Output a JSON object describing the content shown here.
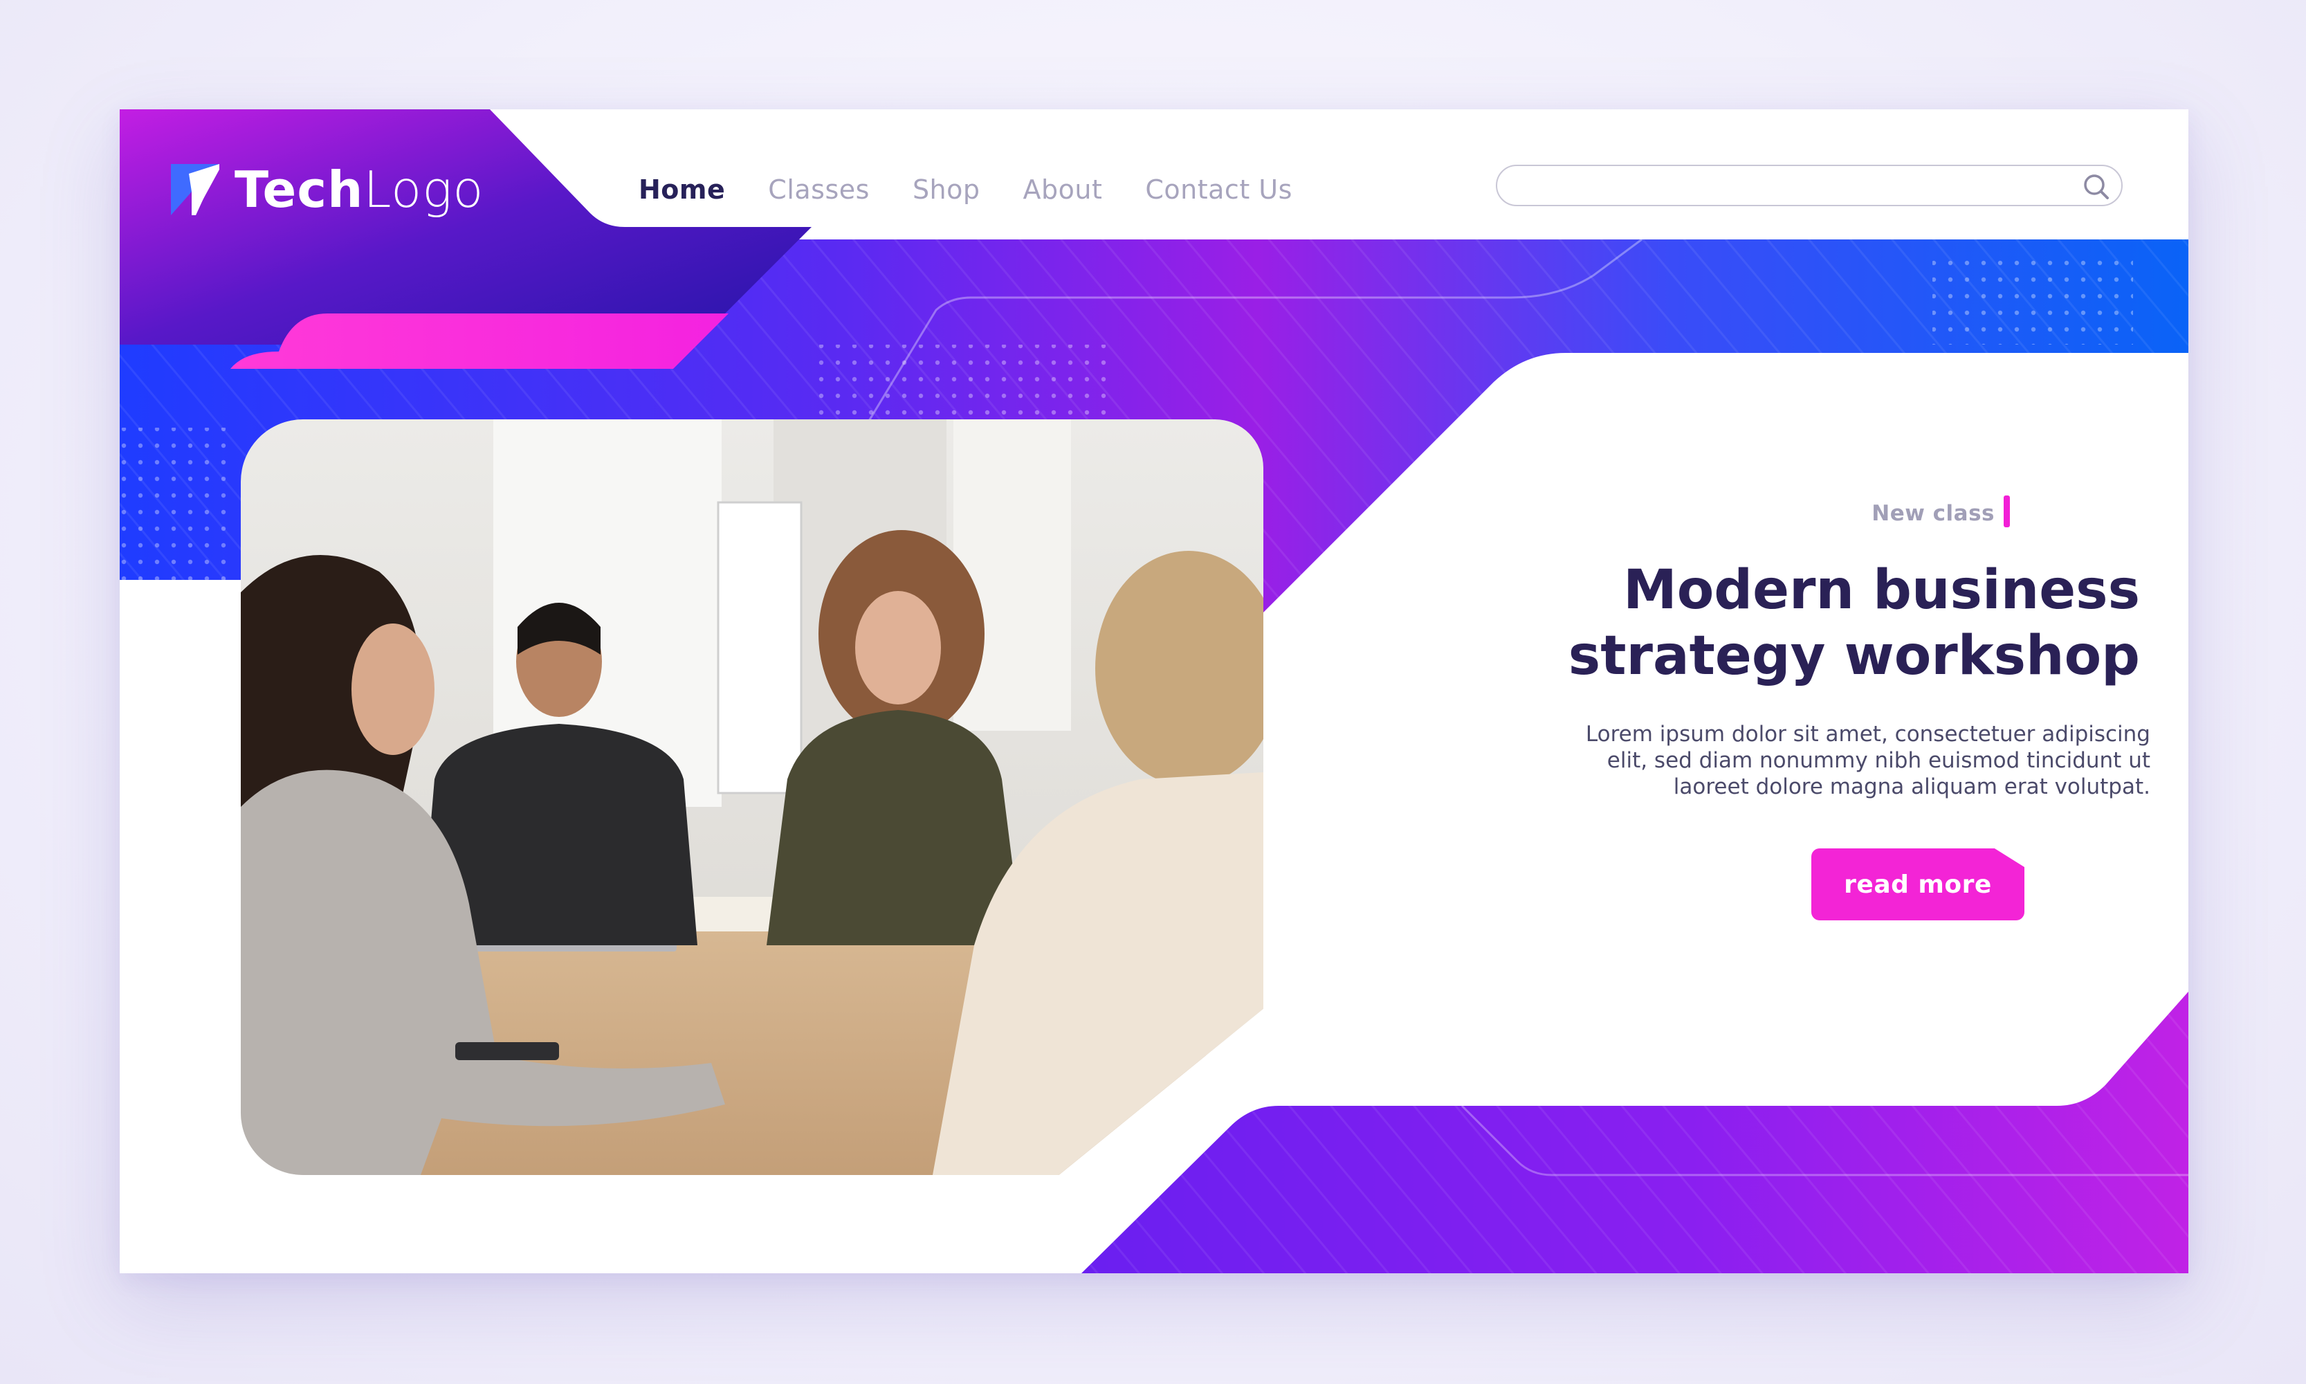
{
  "brand": {
    "logo_bold": "Tech",
    "logo_light": "Logo"
  },
  "nav": {
    "items": [
      {
        "label": "Home",
        "active": true
      },
      {
        "label": "Classes",
        "active": false
      },
      {
        "label": "Shop",
        "active": false
      },
      {
        "label": "About",
        "active": false
      },
      {
        "label": "Contact Us",
        "active": false
      }
    ]
  },
  "search": {
    "value": "",
    "placeholder": ""
  },
  "hero": {
    "tag": "New class",
    "title_line1": "Modern business",
    "title_line2": "strategy workshop",
    "description_line1": "Lorem ipsum dolor sit amet, consectetuer adipiscing",
    "description_line2": "elit, sed diam nonummy nibh euismod tincidunt ut",
    "description_line3": "laoreet dolore magna aliquam erat volutpat.",
    "cta_label": "read more"
  },
  "icons": {
    "logo": "logo-arrow-icon",
    "search": "search-icon"
  },
  "colors": {
    "accent_pink": "#f324d6",
    "brand_purple": "#7b16f0",
    "brand_blue": "#1a4fff",
    "text_dark": "#2a2156",
    "nav_muted": "#a7a4bd"
  }
}
